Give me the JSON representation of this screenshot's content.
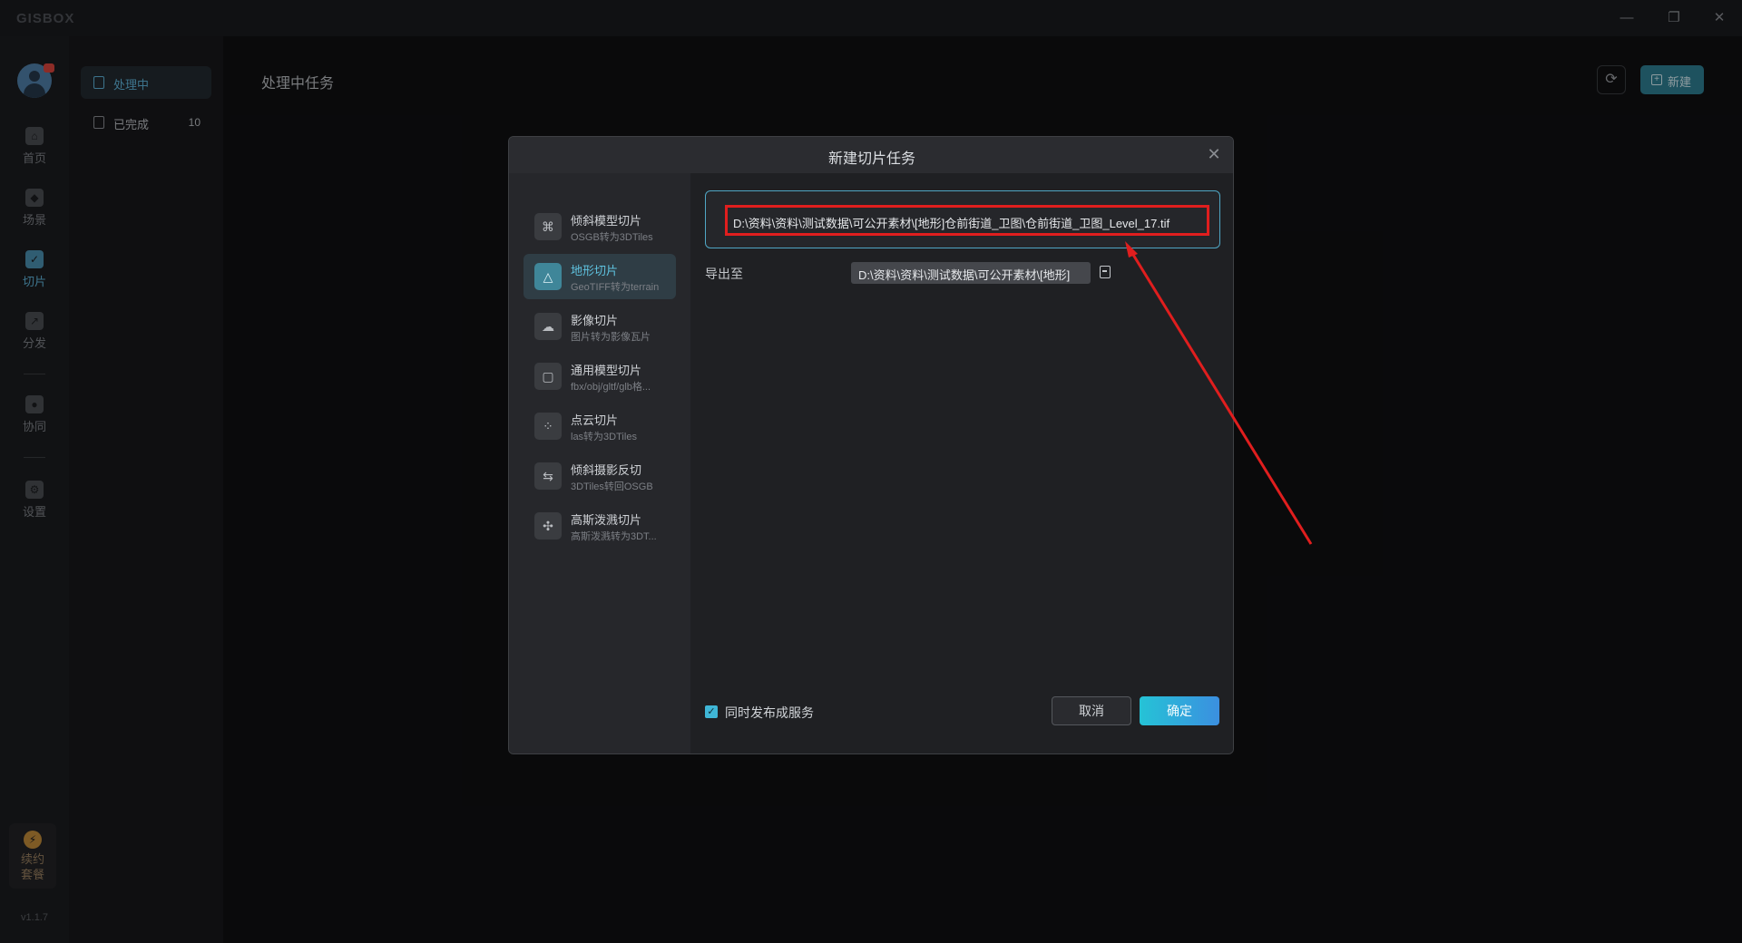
{
  "app": {
    "logo": "GISBOX",
    "version": "v1.1.7"
  },
  "window_controls": {
    "minimize": "—",
    "restore": "❐",
    "close": "✕"
  },
  "rail": {
    "items": [
      {
        "label": "首页",
        "icon": "home-icon",
        "glyph": "⌂"
      },
      {
        "label": "场景",
        "icon": "cube-icon",
        "glyph": "◆"
      },
      {
        "label": "切片",
        "icon": "slice-icon",
        "glyph": "✓"
      },
      {
        "label": "分发",
        "icon": "distribute-icon",
        "glyph": "↗"
      },
      {
        "label": "协同",
        "icon": "lock-icon",
        "glyph": "●"
      },
      {
        "label": "设置",
        "icon": "gear-icon",
        "glyph": "⚙"
      }
    ],
    "subscription": {
      "label_line1": "续约",
      "label_line2": "套餐",
      "icon": "lightning-icon",
      "glyph": "⚡"
    }
  },
  "sidebar": {
    "items": [
      {
        "label": "处理中",
        "count": ""
      },
      {
        "label": "已完成",
        "count": "10"
      }
    ]
  },
  "main": {
    "title": "处理中任务",
    "refresh_glyph": "⟳",
    "new_button": "新建",
    "new_glyph": "+"
  },
  "dialog": {
    "title": "新建切片任务",
    "close_glyph": "✕",
    "categories": [
      {
        "title": "倾斜模型切片",
        "subtitle": "OSGB转为3DTiles",
        "icon": "oblique-model-icon",
        "glyph": "⌘"
      },
      {
        "title": "地形切片",
        "subtitle": "GeoTIFF转为terrain",
        "icon": "terrain-icon",
        "glyph": "△"
      },
      {
        "title": "影像切片",
        "subtitle": "图片转为影像瓦片",
        "icon": "imagery-icon",
        "glyph": "☁"
      },
      {
        "title": "通用模型切片",
        "subtitle": "fbx/obj/gltf/glb格...",
        "icon": "box-icon",
        "glyph": "▢"
      },
      {
        "title": "点云切片",
        "subtitle": "las转为3DTiles",
        "icon": "point-cloud-icon",
        "glyph": "⁘"
      },
      {
        "title": "倾斜摄影反切",
        "subtitle": "3DTiles转回OSGB",
        "icon": "reverse-icon",
        "glyph": "⇆"
      },
      {
        "title": "高斯泼溅切片",
        "subtitle": "高斯泼溅转为3DT...",
        "icon": "gaussian-icon",
        "glyph": "✣"
      }
    ],
    "source_path": "D:\\资料\\资料\\测试数据\\可公开素材\\[地形]仓前街道_卫图\\仓前街道_卫图_Level_17.tif",
    "export_label": "导出至",
    "export_path": "D:\\资料\\资料\\测试数据\\可公开素材\\[地形]",
    "publish_checkbox": {
      "label": "同时发布成服务",
      "checked": true,
      "glyph": "✓"
    },
    "cancel_button": "取消",
    "confirm_button": "确定"
  },
  "colors": {
    "accent": "#3fb6d6",
    "highlight_box": "#e01e1e",
    "annotation_arrow": "#e01e1e"
  }
}
